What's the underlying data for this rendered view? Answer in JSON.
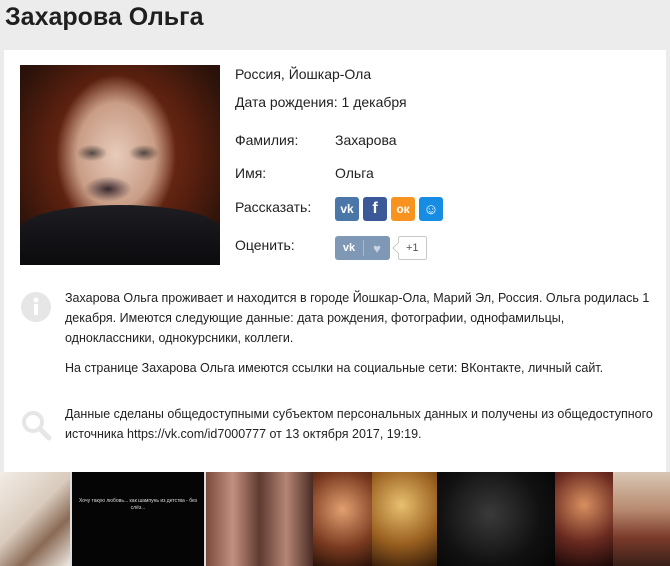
{
  "profile": {
    "name": "Захарова Ольга",
    "location": "Россия, Йошкар-Ола",
    "birthday": "Дата рождения: 1 декабря",
    "fields": [
      {
        "label": "Фамилия:",
        "value": "Захарова"
      },
      {
        "label": "Имя:",
        "value": "Ольга"
      }
    ],
    "share_label": "Рассказать:",
    "rate_label": "Оценить:",
    "share_buttons": [
      {
        "icon": "vk-icon",
        "glyph": "vk",
        "color": "#4a76a8"
      },
      {
        "icon": "facebook-icon",
        "glyph": "f",
        "color": "#3b5998"
      },
      {
        "icon": "odnoklassniki-icon",
        "glyph": "ок",
        "color": "#f7931e"
      },
      {
        "icon": "moimir-icon",
        "glyph": "☺",
        "color": "#168de2"
      }
    ],
    "like": {
      "vk": "vk",
      "heart": "♥",
      "count": "+1",
      "color": "#7f98b6"
    }
  },
  "about": {
    "text1": "Захарова Ольга проживает и находится в городе Йошкар-Ола, Марий Эл, Россия. Ольга родилась 1 декабря. Имеются следующие данные: дата рождения, фотографии, однофамильцы, одноклассники, однокурсники, коллеги.",
    "text2": "На странице Захарова Ольга имеются ссылки на социальные сети: ВКонтакте, личный сайт.",
    "source": "Данные сделаны общедоступными субъектом персональных данных и получены из общедоступного источника https://vk.com/id7000777 от 13 октября 2017, 19:19."
  },
  "gallery": {
    "thumb2_caption": "Хочу такую любовь... как шампунь из детства - без слёз..."
  }
}
